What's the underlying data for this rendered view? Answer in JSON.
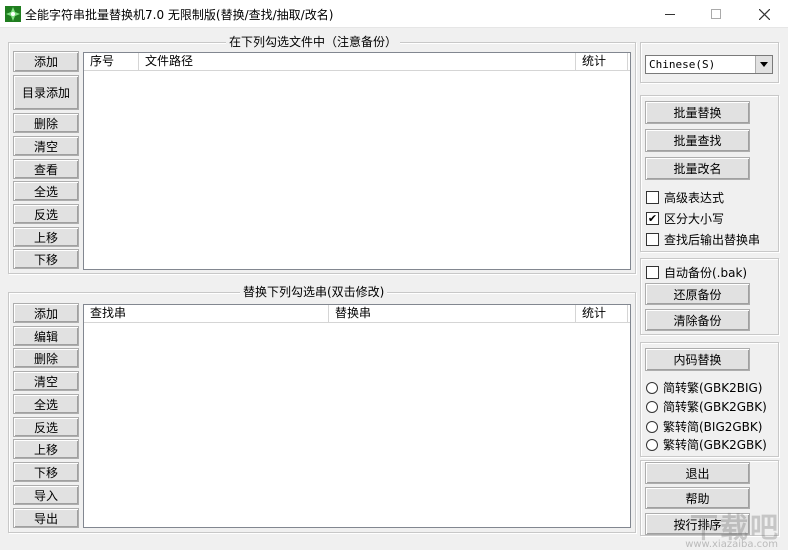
{
  "window": {
    "title": "全能字符串批量替换机7.0 无限制版(替换/查找/抽取/改名)",
    "minimize_icon": "minimize-icon",
    "maximize_icon": "maximize-icon",
    "close_icon": "close-icon",
    "icon_color": "#2e9a2e"
  },
  "files_group": {
    "title": "在下列勾选文件中（注意备份）",
    "buttons": [
      "添加",
      "目录添加",
      "删除",
      "清空",
      "查看",
      "全选",
      "反选",
      "上移",
      "下移"
    ],
    "columns": [
      "序号",
      "文件路径",
      "统计"
    ]
  },
  "replace_group": {
    "title": "替换下列勾选串(双击修改)",
    "buttons": [
      "添加",
      "编辑",
      "删除",
      "清空",
      "全选",
      "反选",
      "上移",
      "下移",
      "导入",
      "导出"
    ],
    "columns": [
      "查找串",
      "替换串",
      "统计"
    ]
  },
  "language": {
    "selected": "Chinese(S)"
  },
  "actions": {
    "batch_replace": "批量替换",
    "batch_find": "批量查找",
    "batch_rename": "批量改名",
    "options": [
      {
        "label": "高级表达式",
        "checked": false
      },
      {
        "label": "区分大小写",
        "checked": true
      },
      {
        "label": "查找后输出替换串",
        "checked": false
      }
    ]
  },
  "backup": {
    "auto_backup": {
      "label": "自动备份(.bak)",
      "checked": false
    },
    "restore": "还原备份",
    "clear": "清除备份"
  },
  "encoding": {
    "button": "内码替换",
    "options": [
      "简转繁(GBK2BIG)",
      "简转繁(GBK2GBK)",
      "繁转简(BIG2GBK)",
      "繁转简(GBK2GBK)"
    ]
  },
  "bottom": {
    "exit": "退出",
    "help": "帮助",
    "sort": "按行排序"
  },
  "watermark": {
    "text": "下载吧",
    "url": "www.xiazaiba.com"
  }
}
